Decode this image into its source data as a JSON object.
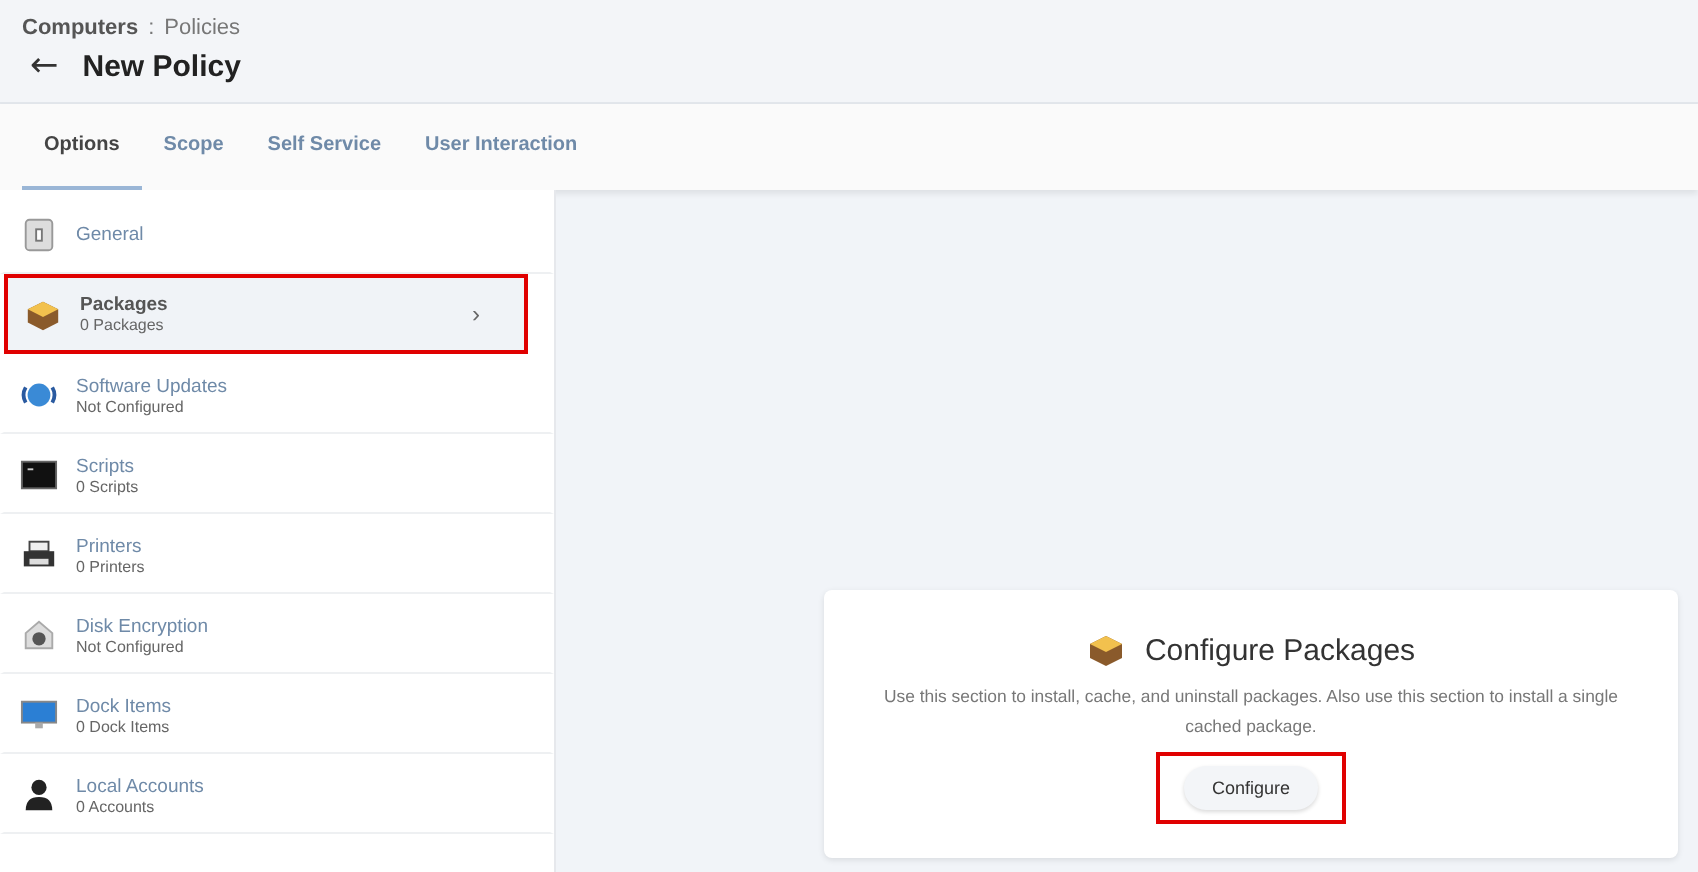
{
  "breadcrumb": {
    "parent": "Computers",
    "separator": ":",
    "current": "Policies"
  },
  "page_title": "New Policy",
  "back_arrow": "←",
  "tabs": [
    {
      "label": "Options",
      "selected": true
    },
    {
      "label": "Scope",
      "selected": false
    },
    {
      "label": "Self Service",
      "selected": false
    },
    {
      "label": "User Interaction",
      "selected": false
    }
  ],
  "sidebar": {
    "items": [
      {
        "title": "General",
        "selected": false,
        "highlighted": false
      },
      {
        "title": "Packages",
        "subtitle": "0 Packages",
        "selected": true,
        "highlighted": true,
        "chevron": "›"
      },
      {
        "title": "Software Updates",
        "subtitle": "Not Configured",
        "selected": false,
        "highlighted": false
      },
      {
        "title": "Scripts",
        "subtitle": "0 Scripts",
        "selected": false,
        "highlighted": false
      },
      {
        "title": "Printers",
        "subtitle": "0 Printers",
        "selected": false,
        "highlighted": false
      },
      {
        "title": "Disk Encryption",
        "subtitle": "Not Configured",
        "selected": false,
        "highlighted": false
      },
      {
        "title": "Dock Items",
        "subtitle": "0 Dock Items",
        "selected": false,
        "highlighted": false
      },
      {
        "title": "Local Accounts",
        "subtitle": "0 Accounts",
        "selected": false,
        "highlighted": false
      }
    ]
  },
  "panel": {
    "title": "Configure Packages",
    "description": "Use this section to install, cache, and uninstall packages. Also use this section to install a single cached package.",
    "button": {
      "label": "Configure",
      "highlighted": true
    }
  }
}
